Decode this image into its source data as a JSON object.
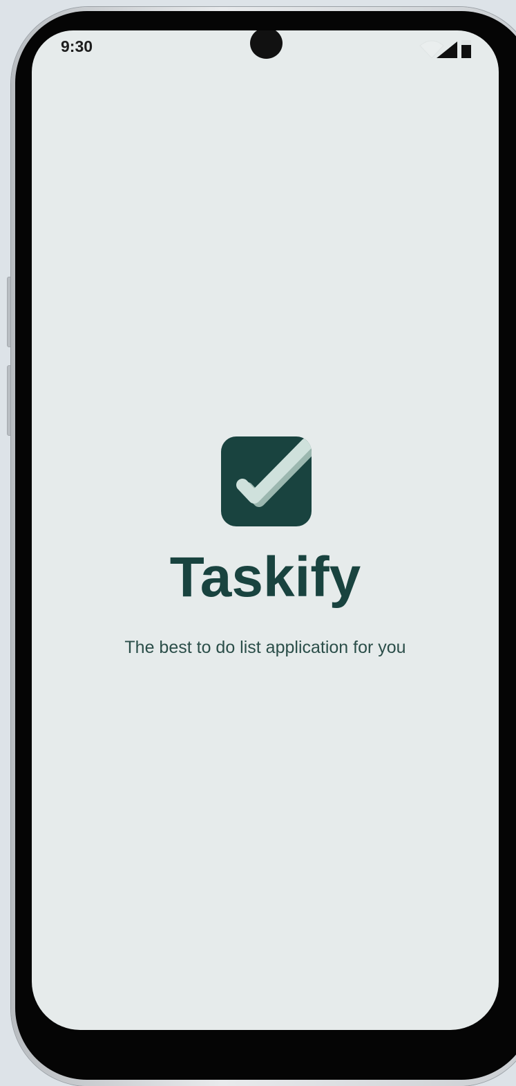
{
  "status_bar": {
    "time": "9:30",
    "wifi_icon": "wifi-icon",
    "signal_icon": "signal-icon",
    "battery_icon": "battery-icon"
  },
  "splash": {
    "logo_icon": "checkbox-check-icon",
    "app_name": "Taskify",
    "tagline": "The best to do list application for you"
  },
  "colors": {
    "primary": "#19433f",
    "screen_background": "#e6ebeb",
    "check_light": "#c9ddd7",
    "check_shadow": "#9bb7af"
  }
}
